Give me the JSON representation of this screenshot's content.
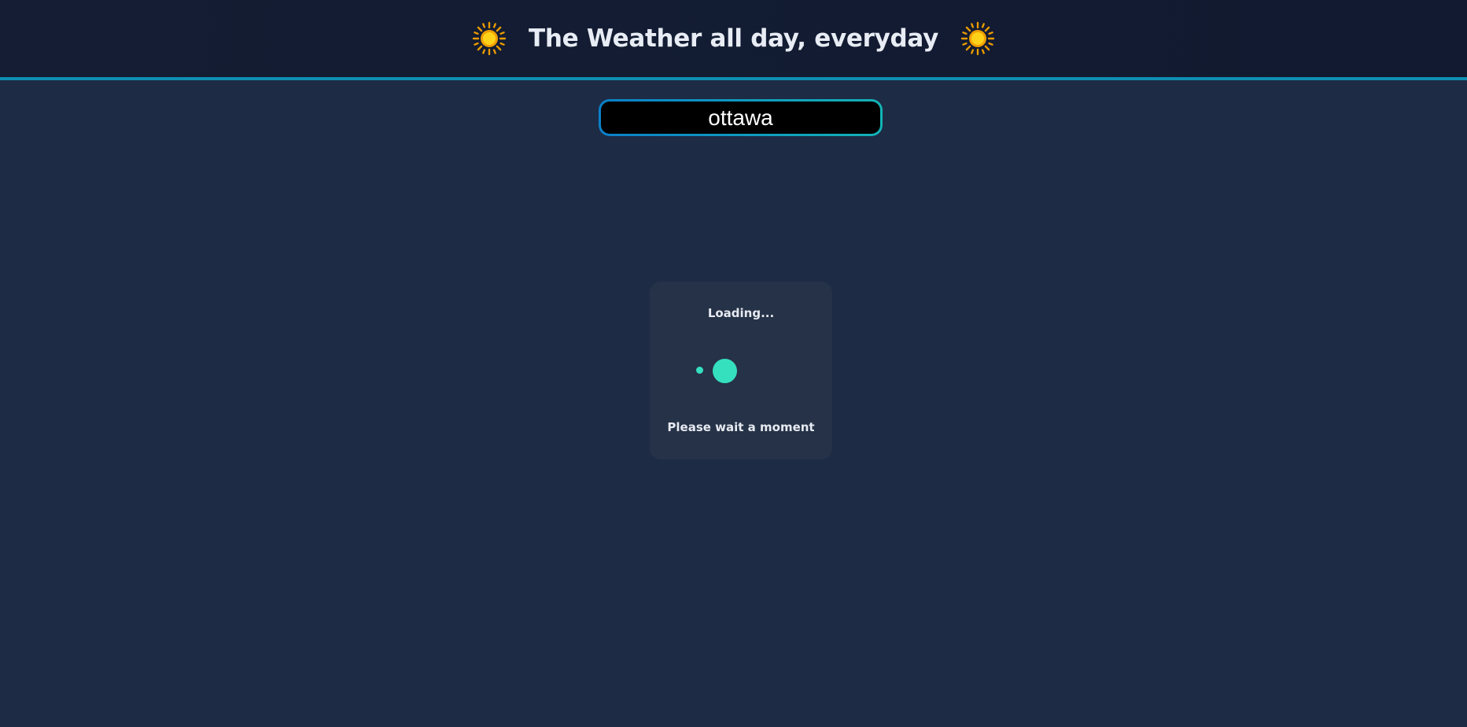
{
  "header": {
    "title": "The Weather all day, everyday",
    "left_icon": "sun-icon",
    "right_icon": "sun-icon"
  },
  "search": {
    "value": "ottawa",
    "placeholder": ""
  },
  "loading": {
    "title": "Loading...",
    "subtitle": "Please wait a moment",
    "indicator": "dots-spinner"
  },
  "colors": {
    "background": "#1e2b45",
    "header_bg": "#131c32",
    "header_border": "#0e8fb3",
    "accent": "#34e0bd",
    "card_bg": "#263247",
    "sun": "#f5b400"
  }
}
